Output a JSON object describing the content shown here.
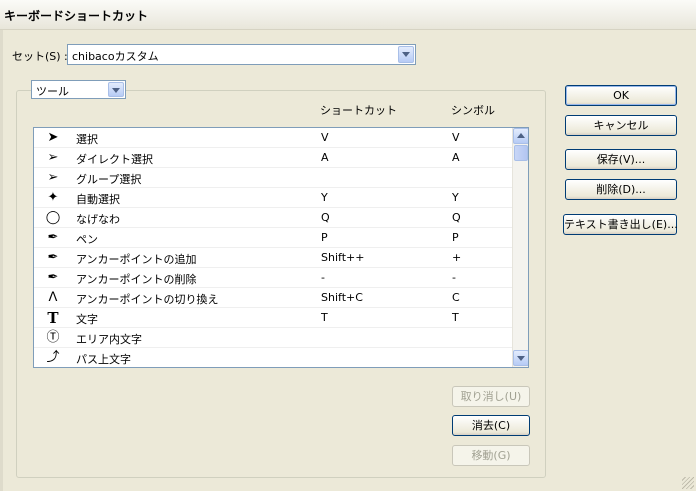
{
  "window": {
    "title": "キーボードショートカット"
  },
  "set": {
    "label": "セット(S) :",
    "value": "chibacoカスタム"
  },
  "category": {
    "value": "ツール"
  },
  "columns": {
    "shortcut": "ショートカット",
    "symbol": "シンボル"
  },
  "tools": [
    {
      "icon": "selection-arrow-icon",
      "glyph": "➤",
      "name": "選択",
      "shortcut": "V",
      "symbol": "V"
    },
    {
      "icon": "direct-selection-icon",
      "glyph": "➢",
      "name": "ダイレクト選択",
      "shortcut": "A",
      "symbol": "A"
    },
    {
      "icon": "group-selection-icon",
      "glyph": "➢",
      "name": "グループ選択",
      "shortcut": "",
      "symbol": ""
    },
    {
      "icon": "magic-wand-icon",
      "glyph": "✦",
      "name": "自動選択",
      "shortcut": "Y",
      "symbol": "Y"
    },
    {
      "icon": "lasso-icon",
      "glyph": "◯",
      "name": "なげなわ",
      "shortcut": "Q",
      "symbol": "Q"
    },
    {
      "icon": "pen-icon",
      "glyph": "✒",
      "name": "ペン",
      "shortcut": "P",
      "symbol": "P"
    },
    {
      "icon": "add-anchor-point-icon",
      "glyph": "✒",
      "name": "アンカーポイントの追加",
      "shortcut": "Shift++",
      "symbol": "+"
    },
    {
      "icon": "delete-anchor-point-icon",
      "glyph": "✒",
      "name": "アンカーポイントの削除",
      "shortcut": "-",
      "symbol": "-"
    },
    {
      "icon": "convert-anchor-point-icon",
      "glyph": "ᐱ",
      "name": "アンカーポイントの切り換え",
      "shortcut": "Shift+C",
      "symbol": "C"
    },
    {
      "icon": "type-icon",
      "glyph": "T",
      "name": "文字",
      "shortcut": "T",
      "symbol": "T"
    },
    {
      "icon": "area-type-icon",
      "glyph": "Ⓣ",
      "name": "エリア内文字",
      "shortcut": "",
      "symbol": ""
    },
    {
      "icon": "type-on-path-icon",
      "glyph": "⤴",
      "name": "パス上文字",
      "shortcut": "",
      "symbol": ""
    }
  ],
  "buttons": {
    "ok": "OK",
    "cancel": "キャンセル",
    "save": "保存(V)...",
    "delete": "削除(D)...",
    "export_text": "テキスト書き出し(E)...",
    "undo": "取り消し(U)",
    "clear": "消去(C)",
    "go_to": "移動(G)"
  }
}
